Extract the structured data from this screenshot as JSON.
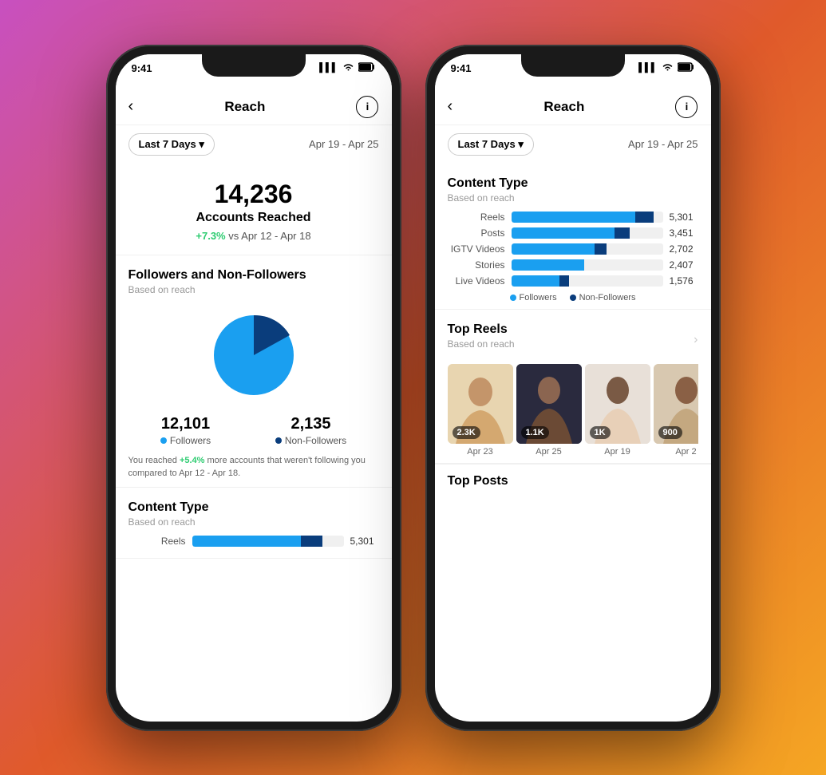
{
  "background": {
    "gradient_start": "#c850c0",
    "gradient_mid": "#e05a2b",
    "gradient_end": "#f5a623"
  },
  "phone1": {
    "status": {
      "time": "9:41",
      "signal": "▌▌▌",
      "wifi": "WiFi",
      "battery": "🔋"
    },
    "header": {
      "back_label": "‹",
      "title": "Reach",
      "info_label": "i"
    },
    "filter": {
      "label": "Last 7 Days ▾",
      "date_range": "Apr 19 - Apr 25"
    },
    "hero": {
      "number": "14,236",
      "label": "Accounts Reached",
      "change_text": "vs Apr 12 - Apr 18",
      "change_value": "+7.3%"
    },
    "followers_section": {
      "title": "Followers and Non-Followers",
      "subtitle": "Based on reach",
      "followers_count": "12,101",
      "followers_label": "Followers",
      "nonfollowers_count": "2,135",
      "nonfollowers_label": "Non-Followers",
      "note_prefix": "You reached",
      "note_value": "+5.4%",
      "note_suffix": "more accounts that weren't following you compared to Apr 12 - Apr 18."
    },
    "content_type": {
      "title": "Content Type",
      "subtitle": "Based on reach",
      "bars": [
        {
          "label": "Reels",
          "followers_pct": 72,
          "nonfollowers_pct": 14,
          "value": "5,301"
        }
      ]
    }
  },
  "phone2": {
    "status": {
      "time": "9:41"
    },
    "header": {
      "back_label": "‹",
      "title": "Reach",
      "info_label": "i"
    },
    "filter": {
      "label": "Last 7 Days ▾",
      "date_range": "Apr 19 - Apr 25"
    },
    "content_type": {
      "title": "Content Type",
      "subtitle": "Based on reach",
      "bars": [
        {
          "label": "Reels",
          "followers_pct": 82,
          "nonfollowers_pct": 12,
          "value": "5,301"
        },
        {
          "label": "Posts",
          "followers_pct": 68,
          "nonfollowers_pct": 10,
          "value": "3,451"
        },
        {
          "label": "IGTV Videos",
          "followers_pct": 55,
          "nonfollowers_pct": 8,
          "value": "2,702"
        },
        {
          "label": "Stories",
          "followers_pct": 48,
          "nonfollowers_pct": 0,
          "value": "2,407"
        },
        {
          "label": "Live Videos",
          "followers_pct": 32,
          "nonfollowers_pct": 6,
          "value": "1,576"
        }
      ],
      "legend_followers": "Followers",
      "legend_nonfollowers": "Non-Followers"
    },
    "top_reels": {
      "title": "Top Reels",
      "subtitle": "Based on reach",
      "reels": [
        {
          "count": "2.3K",
          "date": "Apr 23"
        },
        {
          "count": "1.1K",
          "date": "Apr 25"
        },
        {
          "count": "1K",
          "date": "Apr 19"
        },
        {
          "count": "900",
          "date": "Apr 2"
        }
      ]
    },
    "top_posts": {
      "title": "Top Posts"
    }
  }
}
